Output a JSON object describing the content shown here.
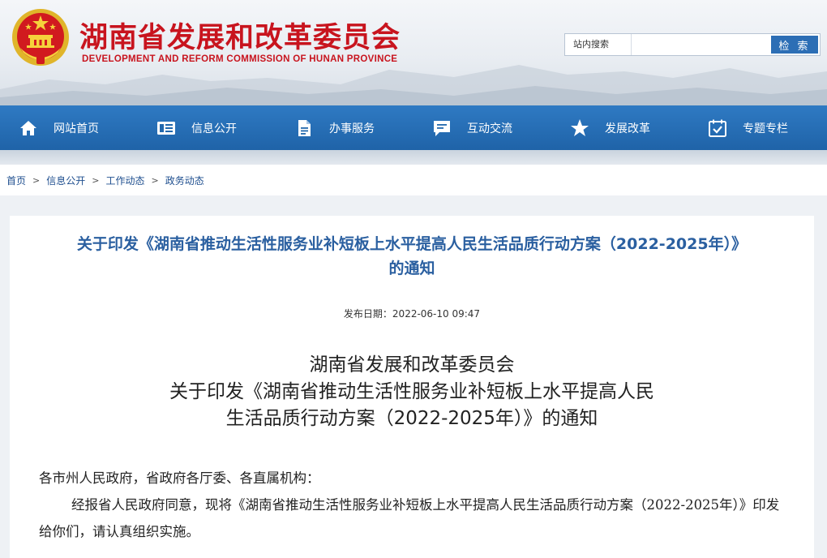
{
  "header": {
    "title": "湖南省发展和改革委员会",
    "subtitle": "DEVELOPMENT AND REFORM COMMISSION OF HUNAN PROVINCE",
    "brand_color": "#c8141e"
  },
  "search": {
    "label": "站内搜索",
    "value": "",
    "button_label": "检 索"
  },
  "nav": {
    "items": [
      {
        "label": "网站首页",
        "icon": "home-icon"
      },
      {
        "label": "信息公开",
        "icon": "info-card-icon"
      },
      {
        "label": "办事服务",
        "icon": "document-icon"
      },
      {
        "label": "互动交流",
        "icon": "chat-icon"
      },
      {
        "label": "发展改革",
        "icon": "star-icon"
      },
      {
        "label": "专题专栏",
        "icon": "calendar-check-icon"
      }
    ],
    "color": "#2268ad"
  },
  "breadcrumb": {
    "items": [
      "首页",
      "信息公开",
      "工作动态",
      "政务动态"
    ],
    "separator": ">"
  },
  "article": {
    "title_line1": "关于印发《湖南省推动生活性服务业补短板上水平提高人民生活品质行动方案（2022-2025年）》",
    "title_line2": "的通知",
    "date": "发布日期：2022-06-10 09:47",
    "heading_line1": "湖南省发展和改革委员会",
    "heading_line2": "关于印发《湖南省推动生活性服务业补短板上水平提高人民",
    "heading_line3": "生活品质行动方案（2022-2025年）》的通知",
    "salutation": "各市州人民政府，省政府各厅委、各直属机构：",
    "paragraph1": "经报省人民政府同意，现将《湖南省推动生活性服务业补短板上水平提高人民生活品质行动方案（2022-2025年）》印发给你们，请认真组织实施。"
  }
}
